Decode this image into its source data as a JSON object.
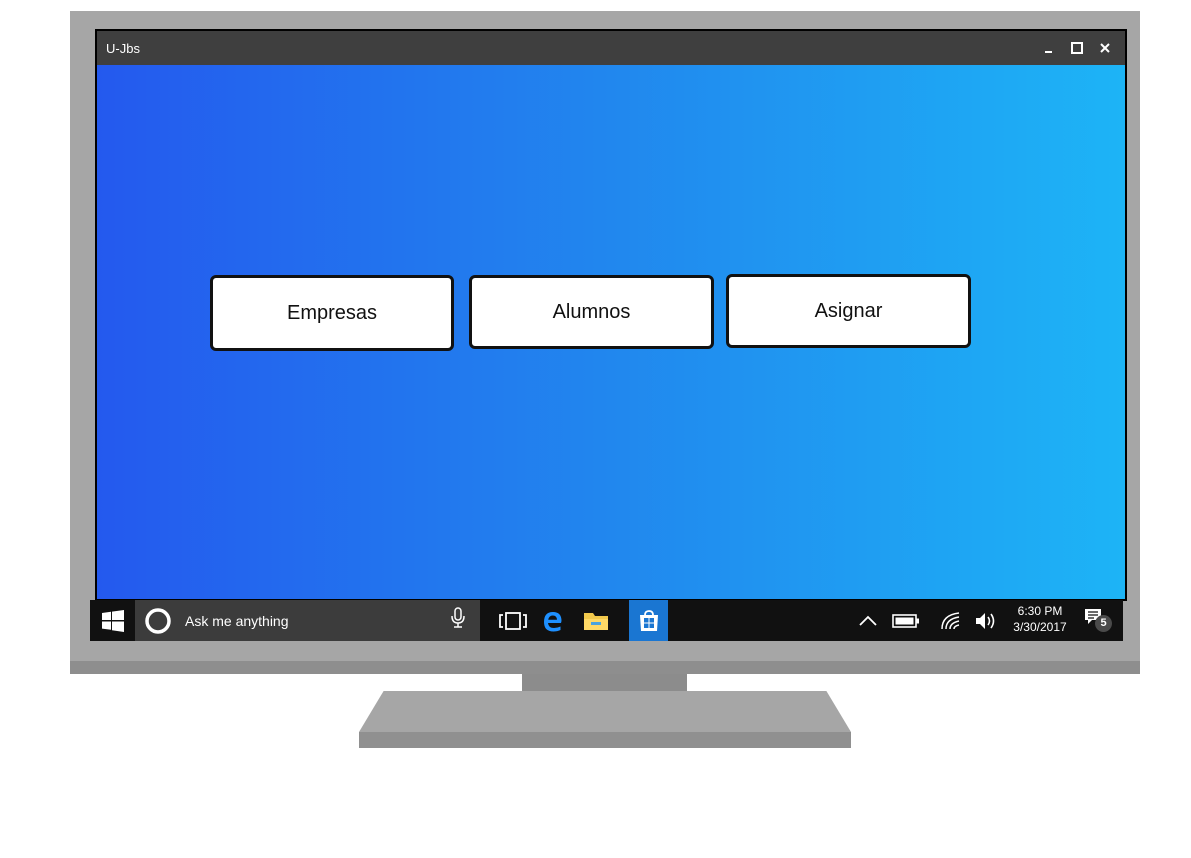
{
  "window": {
    "title": "U-Jbs",
    "controls": {
      "minimize_icon": "minimize-icon",
      "maximize_icon": "maximize-icon",
      "close_icon": "close-icon"
    }
  },
  "main": {
    "buttons": [
      {
        "label": "Empresas"
      },
      {
        "label": "Alumnos"
      },
      {
        "label": "Asignar"
      }
    ],
    "gradient": {
      "start": "#2459ee",
      "end": "#1db4f6"
    }
  },
  "taskbar": {
    "search_placeholder": "Ask me anything",
    "time": "6:30 PM",
    "date": "3/30/2017",
    "notification_count": "5",
    "icons": [
      "windows-start-icon",
      "cortana-icon",
      "microphone-icon",
      "task-view-icon",
      "edge-browser-icon",
      "file-explorer-icon",
      "store-icon",
      "chevron-up-icon",
      "battery-icon",
      "wifi-icon",
      "volume-icon",
      "action-center-icon"
    ]
  }
}
